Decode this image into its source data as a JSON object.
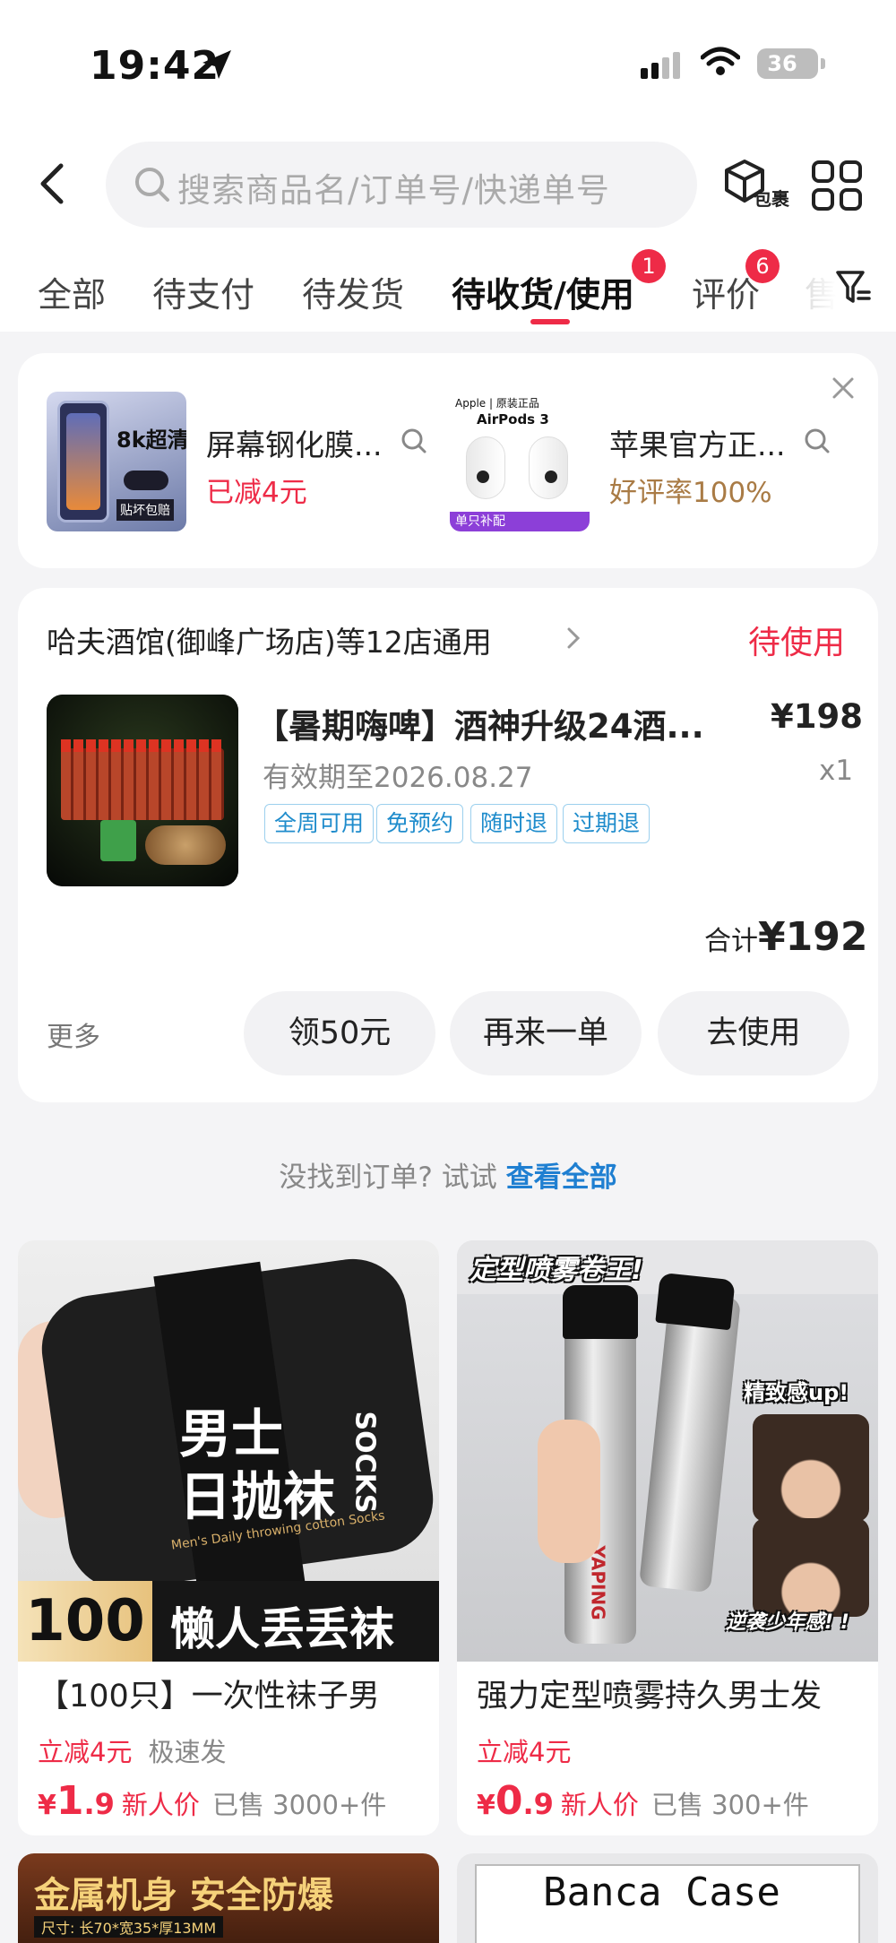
{
  "status_bar": {
    "time": "19:42",
    "battery": "36"
  },
  "search": {
    "placeholder": "搜索商品名/订单号/快递单号"
  },
  "header": {
    "package_label": "包裹"
  },
  "tabs": [
    {
      "label": "全部"
    },
    {
      "label": "待支付"
    },
    {
      "label": "待发货"
    },
    {
      "label": "待收货/使用",
      "badge": "1"
    },
    {
      "label": "评价",
      "badge": "6"
    },
    {
      "label": "售"
    }
  ],
  "recommend": [
    {
      "title": "屏幕钢化膜...",
      "sub": "已减4元",
      "image_text": "8k超清",
      "image_sub": "贴坏包赔"
    },
    {
      "title": "苹果官方正...",
      "sub": "好评率100%",
      "image_text": "AirPods 3",
      "image_brand": "Apple | 原装正品",
      "image_sub": "单只补配"
    }
  ],
  "order": {
    "shop": "哈夫酒馆(御峰广场店)等12店通用",
    "status": "待使用",
    "title": "【暑期嗨啤】酒神升级24酒...",
    "price": "¥198",
    "valid": "有效期至2026.08.27",
    "qty": "x1",
    "tags": [
      "全周可用",
      "免预约",
      "随时退",
      "过期退"
    ],
    "total_label": "合计",
    "total_value": "¥192",
    "more": "更多",
    "buttons": [
      "领50元",
      "再来一单",
      "去使用"
    ]
  },
  "not_found": {
    "text": "没找到订单? 试试 ",
    "link": "查看全部"
  },
  "products": [
    {
      "name": "【100只】一次性袜子男",
      "promo": "立减4元",
      "ship": "极速发",
      "price_currency": "¥",
      "price_int": "1",
      "price_dec": ".9",
      "newp": "新人价",
      "sold": "已售 3000+件",
      "img_title_1": "男士",
      "img_title_2": "日抛袜",
      "img_brand": "SOCKS",
      "img_en": "Men's Daily throwing cotton Socks",
      "img_count": "100",
      "img_banner": "懒人丢丢袜"
    },
    {
      "name": "强力定型喷雾持久男士发",
      "promo": "立减4元",
      "ship": "",
      "price_currency": "¥",
      "price_int": "0",
      "price_dec": ".9",
      "newp": "新人价",
      "sold": "已售 300+件",
      "img_top": "定型喷雾卷王!",
      "img_right": "精致感up!",
      "img_bottom": "逆袭少年感! !",
      "img_brand": "YAPING"
    }
  ],
  "bottom_cards": [
    {
      "text": "金属机身 安全防爆",
      "sub": "尺寸: 长70*宽35*厚13MM"
    },
    {
      "text": "Banca Case"
    }
  ],
  "colors": {
    "accent": "#ee2b47",
    "link": "#1f7fd1"
  }
}
